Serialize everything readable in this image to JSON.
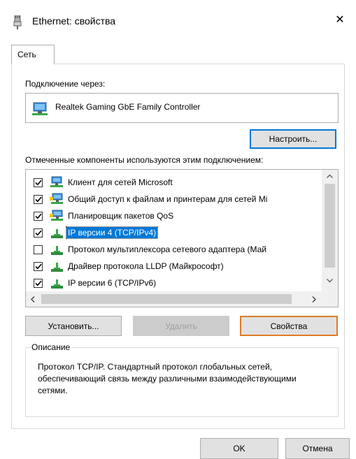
{
  "window": {
    "title": "Ethernet: свойства",
    "close_glyph": "✕"
  },
  "tab": {
    "label": "Сеть"
  },
  "connection": {
    "label": "Подключение через:",
    "adapter": "Realtek Gaming GbE Family Controller",
    "configure_label": "Настроить..."
  },
  "components": {
    "label": "Отмеченные компоненты используются этим подключением:",
    "items": [
      {
        "text": "Клиент для сетей Microsoft",
        "checked": true,
        "icon": "network-client-icon"
      },
      {
        "text": "Общий доступ к файлам и принтерам для сетей Mi",
        "checked": true,
        "icon": "network-service-icon"
      },
      {
        "text": "Планировщик пакетов QoS",
        "checked": true,
        "icon": "network-service-icon"
      },
      {
        "text": "IP версии 4 (TCP/IPv4)",
        "checked": true,
        "icon": "protocol-icon",
        "selected": true
      },
      {
        "text": "Протокол мультиплексора сетевого адаптера (Май",
        "checked": false,
        "icon": "protocol-icon"
      },
      {
        "text": "Драйвер протокола LLDP (Майкрософт)",
        "checked": true,
        "icon": "protocol-icon"
      },
      {
        "text": "IP версии 6 (TCP/IPv6)",
        "checked": true,
        "icon": "protocol-icon"
      }
    ]
  },
  "buttons": {
    "install": "Установить...",
    "remove": "Удалить",
    "properties": "Свойства",
    "ok": "OK",
    "cancel": "Отмена"
  },
  "description": {
    "legend": "Описание",
    "text": "Протокол TCP/IP. Стандартный протокол глобальных сетей, обеспечивающий связь между различными взаимодействующими сетями."
  }
}
